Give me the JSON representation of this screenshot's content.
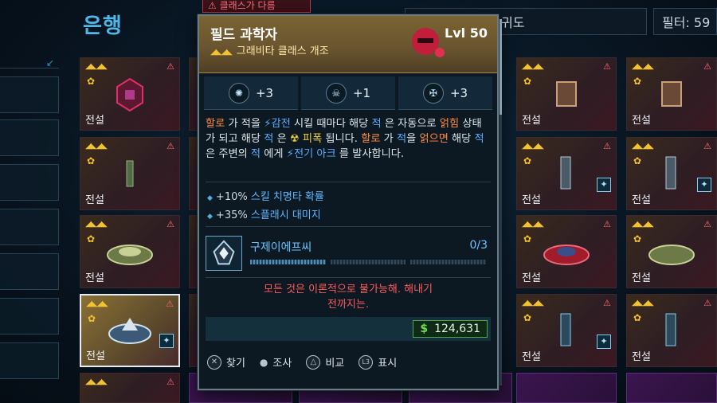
{
  "header": {
    "title": "은행",
    "sort_value": "귀도",
    "filter_label": "필터: 59"
  },
  "warning_tab": "클래스가 다름",
  "grid": {
    "cards": [
      {
        "label": "전설",
        "rarity": "legendary"
      },
      {
        "label": "전설",
        "rarity": "legendary"
      },
      {
        "label": "전설",
        "rarity": "legendary"
      },
      {
        "label": "전설",
        "rarity": "legendary",
        "selected": true
      },
      {
        "label": "전설",
        "rarity": "legendary"
      },
      {
        "label": "전설",
        "rarity": "legendary"
      },
      {
        "label": "전설",
        "rarity": "legendary"
      },
      {
        "label": "전설",
        "rarity": "legendary"
      },
      {
        "label": "전설",
        "rarity": "legendary"
      },
      {
        "label": "전설",
        "rarity": "legendary"
      },
      {
        "label": "전설",
        "rarity": "legendary"
      },
      {
        "label": "전설",
        "rarity": "legendary"
      }
    ]
  },
  "tooltip": {
    "name": "필드 과학자",
    "subtype": "그래비타 클래스 개조",
    "level": "Lvl 50",
    "bonuses": [
      {
        "icon": "skill-1-icon",
        "value": "+3"
      },
      {
        "icon": "skill-2-icon",
        "value": "+1"
      },
      {
        "icon": "skill-3-icon",
        "value": "+3"
      }
    ],
    "desc": {
      "p1": "할로",
      "p2": " 가 적을 ",
      "p3": "⚡감전",
      "p4": " 시킬 때마다 해당 ",
      "p5": "적",
      "p6": " 은 자동으로 ",
      "p7": "얽힘",
      "p8": " 상태가 되고 해당 ",
      "p9": "적",
      "p10": " 은 ",
      "p11": "☢ 피폭",
      "p12": " 됩니다. ",
      "p13": "할로",
      "p14": " 가 ",
      "p15": "적",
      "p16": "을 ",
      "p17": "얽으면",
      "p18": " 해당 ",
      "p19": "적",
      "p20": " 은 주변의 ",
      "p21": "적",
      "p22": " 에게 ",
      "p23": "⚡전기 아크",
      "p24": " 를 발사합니다."
    },
    "stats": [
      {
        "value": "+10%",
        "text": "스킬 치명타 확률"
      },
      {
        "value": "+35%",
        "text": "스플래시 대미지"
      }
    ],
    "anoint": {
      "name": "구제이에프씨",
      "progress": "0/3"
    },
    "flavor_line1": "모든 것은 이론적으로 불가능해. 해내기",
    "flavor_line2": "전까지는.",
    "price_symbol": "$",
    "price": "124,631",
    "actions": {
      "find": "찾기",
      "inspect": "조사",
      "compare": "비교",
      "display": "표시",
      "l3_label": "L3"
    }
  },
  "colors": {
    "accent": "#4fb8e8",
    "warning": "#ff5a5a",
    "legendary": "#f2c230",
    "money": "#6edc4c"
  }
}
